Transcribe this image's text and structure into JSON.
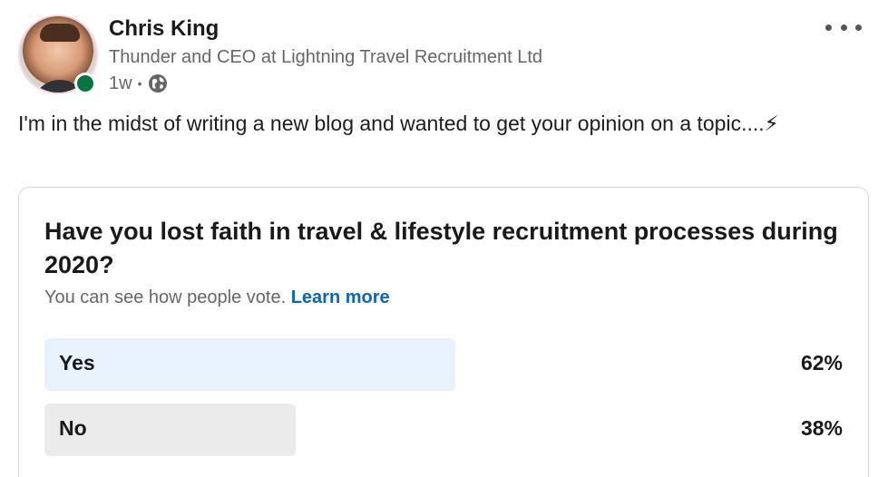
{
  "author": {
    "name": "Chris King",
    "headline": "Thunder and CEO at Lightning Travel Recruitment Ltd",
    "time": "1w",
    "separator": "•"
  },
  "post": {
    "text": "I'm in the midst of writing a new blog and wanted to get your opinion on a topic....⚡"
  },
  "poll": {
    "question": "Have you lost faith in travel & lifestyle recruitment processes during 2020?",
    "note": "You can see how people vote.",
    "learn_more": "Learn more",
    "options": [
      {
        "label": "Yes",
        "percent_text": "62%",
        "percent": 62,
        "color": "#e8f2fd",
        "selected": true
      },
      {
        "label": "No",
        "percent_text": "38%",
        "percent": 38,
        "color": "#ebebeb",
        "selected": false
      }
    ]
  },
  "colors": {
    "link": "#0a66c2",
    "online": "#057642",
    "muted_text": "#666666"
  },
  "icons": [
    "globe-icon",
    "more-icon",
    "lightning-emoji"
  ]
}
